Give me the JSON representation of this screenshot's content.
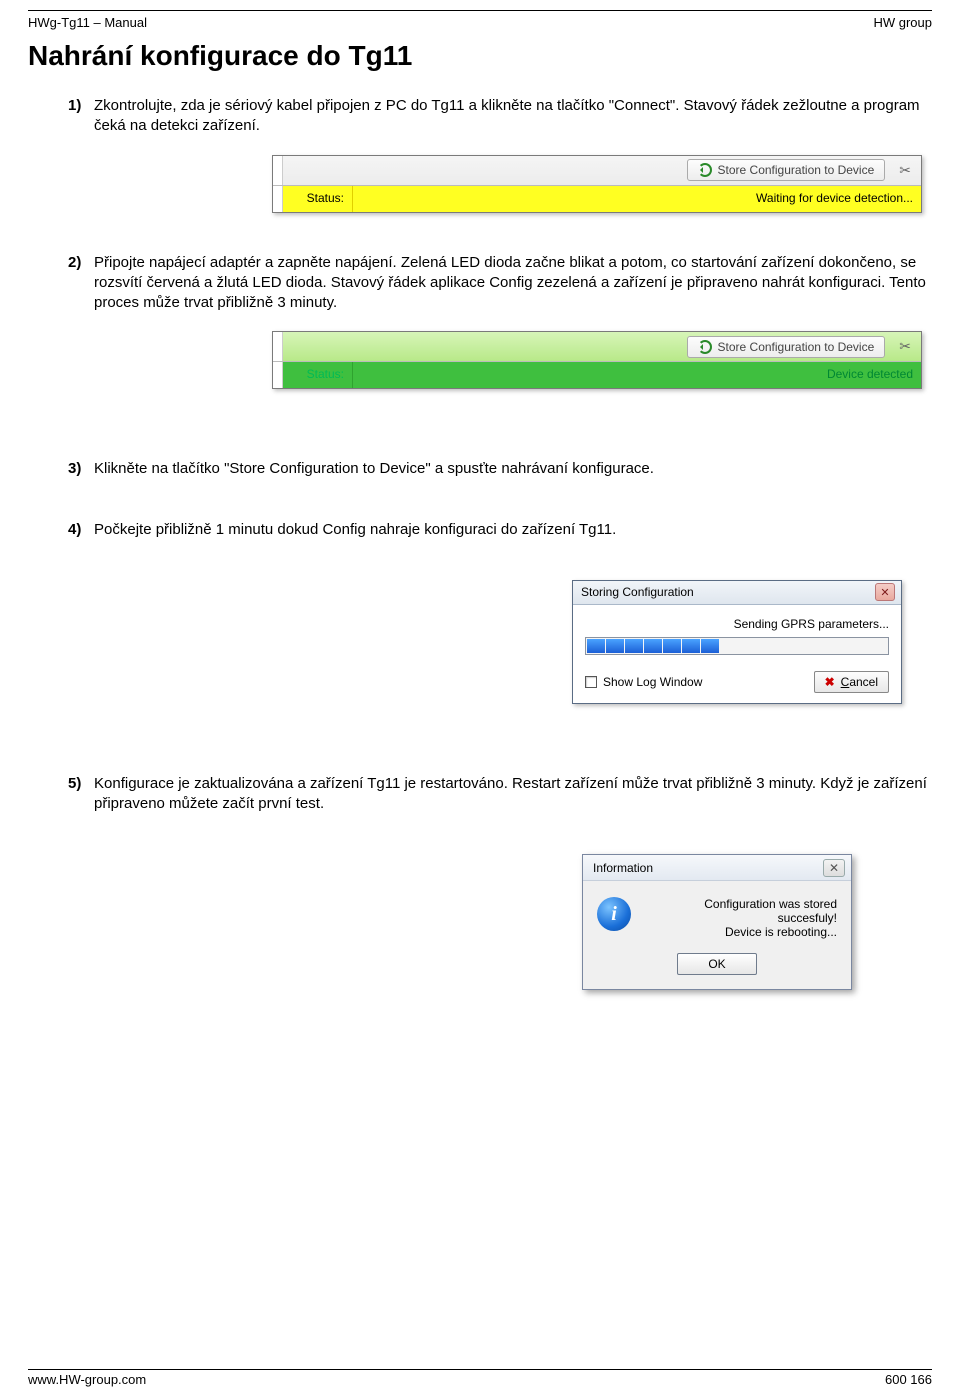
{
  "header": {
    "left": "HWg-Tg11 – Manual",
    "right": "HW group"
  },
  "title": "Nahrání konfigurace do Tg11",
  "steps": {
    "s1": {
      "num": "1)",
      "text": "Zkontrolujte, zda je sériový kabel připojen z PC do Tg11 a klikněte na tlačítko \"Connect\". Stavový řádek zežloutne a program čeká na detekci zařízení."
    },
    "s2": {
      "num": "2)",
      "text": "Připojte napájecí adaptér a zapněte napájení. Zelená LED dioda začne blikat a potom, co startování zařízení dokončeno, se rozsvítí červená a žlutá LED dioda. Stavový řádek aplikace Config zezelená a zařízení je připraveno nahrát konfiguraci. Tento proces může trvat přibližně 3 minuty."
    },
    "s3": {
      "num": "3)",
      "text": "Klikněte na tlačítko \"Store Configuration to Device\" a spusťte nahrávaní konfigurace."
    },
    "s4": {
      "num": "4)",
      "text": "Počkejte přibližně 1 minutu dokud Config nahraje konfiguraci do zařízení Tg11."
    },
    "s5": {
      "num": "5)",
      "text": "Konfigurace je zaktualizována a zařízení Tg11 je restartováno. Restart zařízení může trvat přibližně 3 minuty. Když je zařízení připraveno můžete začít první test."
    }
  },
  "shot_status": {
    "store_btn": "Store Configuration to Device",
    "scissor": "✂",
    "status_label": "Status:",
    "yellow_value": "Waiting for device detection...",
    "green_value": "Device detected"
  },
  "progress_dialog": {
    "title": "Storing Configuration",
    "close": "✕",
    "msg": "Sending GPRS parameters...",
    "show_log": "Show Log Window",
    "cancel": "Cancel"
  },
  "info_dialog": {
    "title": "Information",
    "close": "✕",
    "line1": "Configuration was stored succesfuly!",
    "line2": "Device is rebooting...",
    "ok": "OK"
  },
  "footer": {
    "left": "www.HW-group.com",
    "right": "600 166"
  }
}
